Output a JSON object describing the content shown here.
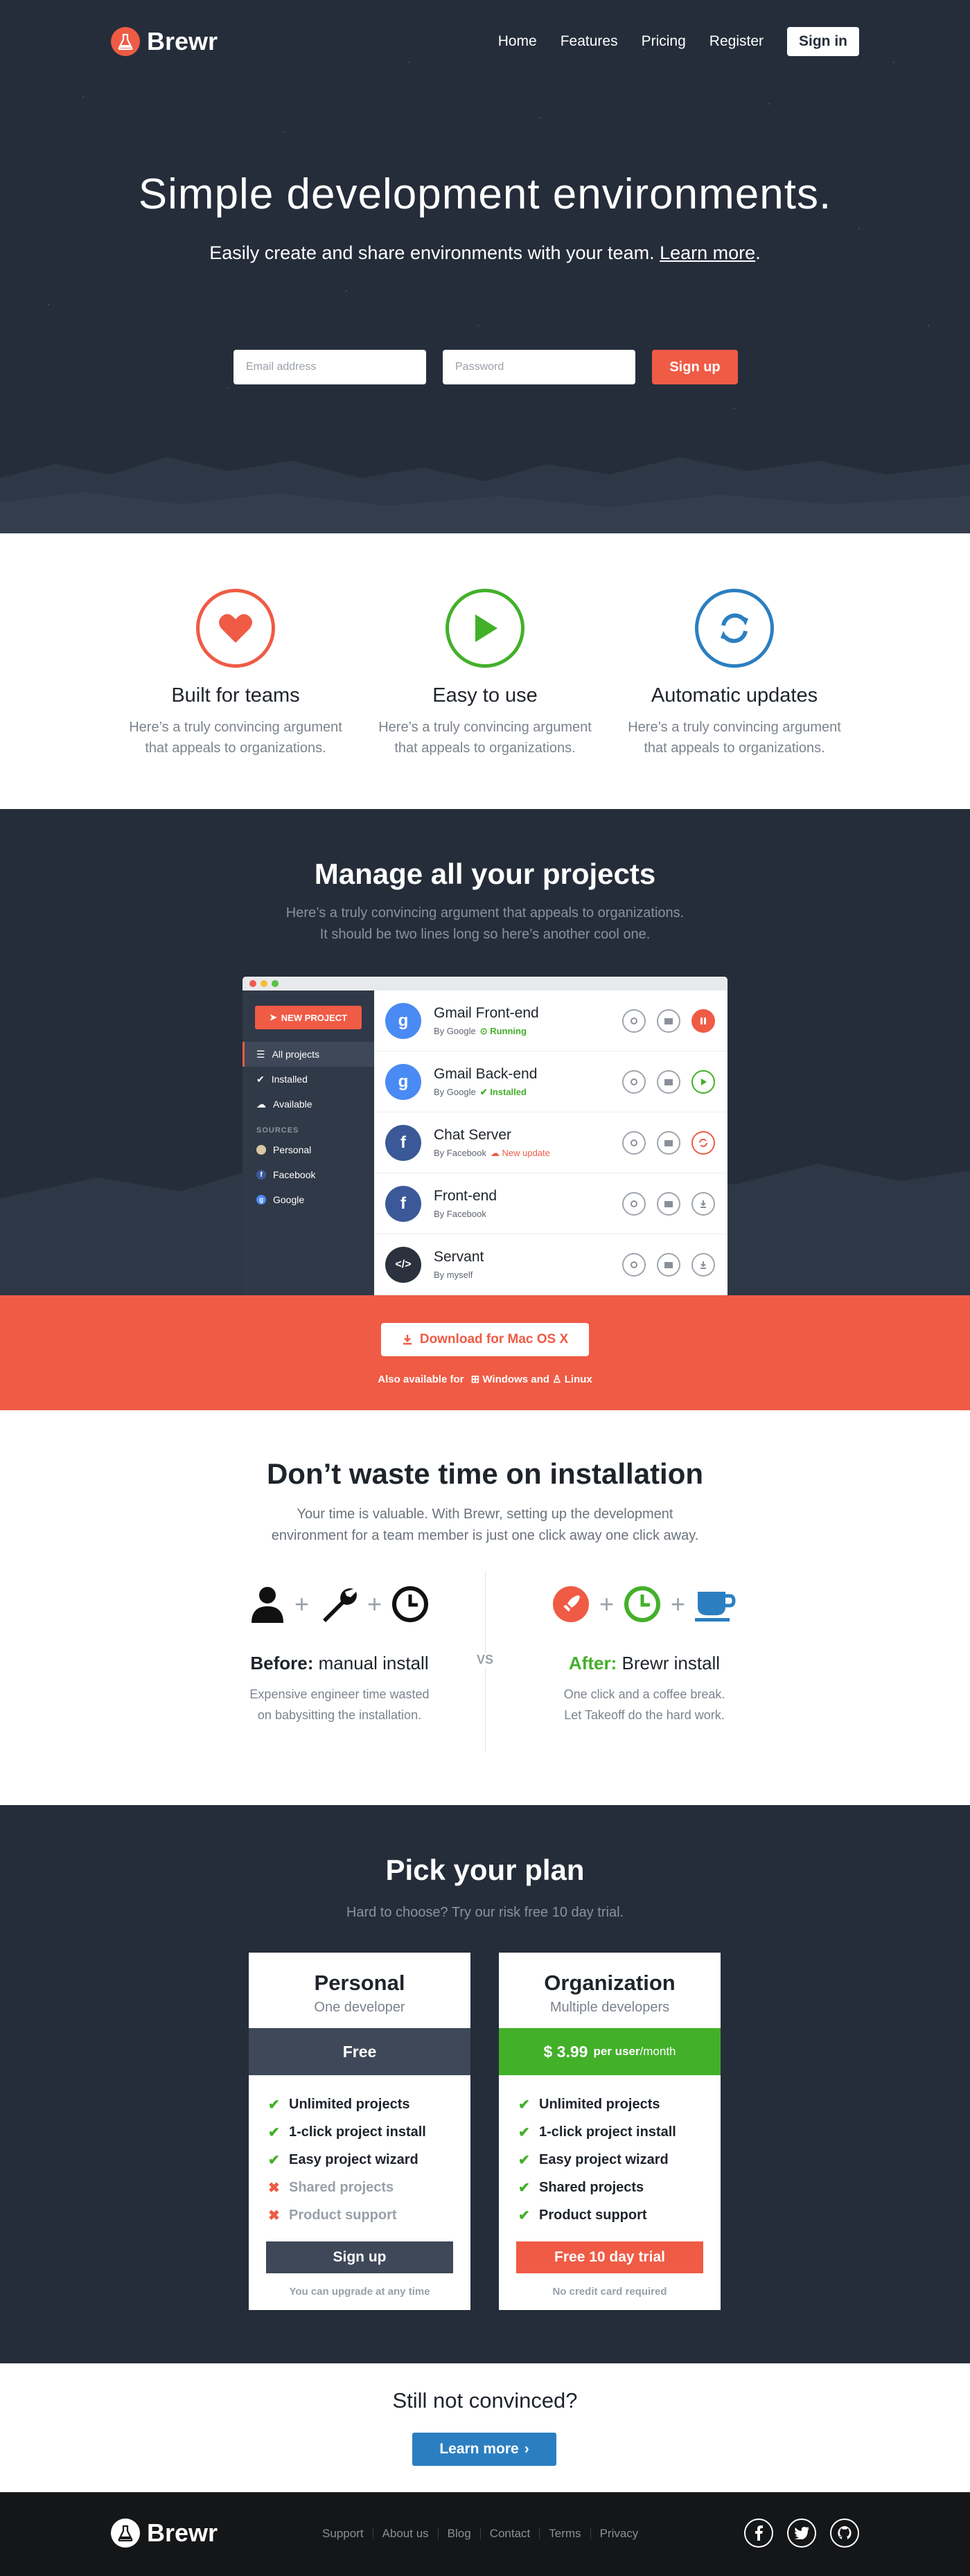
{
  "brand": {
    "name": "Brewr",
    "accent": "#ef5b45",
    "dark": "#252d3a",
    "green": "#43b02a",
    "blue": "#2b7fc1"
  },
  "nav": {
    "links": [
      "Home",
      "Features",
      "Pricing",
      "Register"
    ],
    "signin": "Sign in"
  },
  "hero": {
    "title": "Simple development environments.",
    "subtitle": "Easily create and share environments with your team.",
    "subtitle_link": "Learn more",
    "email_placeholder": "Email address",
    "password_placeholder": "Password",
    "signup": "Sign up"
  },
  "features": [
    {
      "icon": "heart-icon",
      "title": "Built for teams",
      "desc1": "Here’s a truly convincing argument",
      "desc2": "that appeals to organizations."
    },
    {
      "icon": "play-icon",
      "title": "Easy to use",
      "desc1": "Here’s a truly convincing argument",
      "desc2": "that appeals to organizations."
    },
    {
      "icon": "refresh-icon",
      "title": "Automatic updates",
      "desc1": "Here’s a truly convincing argument",
      "desc2": "that appeals to organizations."
    }
  ],
  "manage": {
    "title": "Manage all your projects",
    "desc1": "Here’s a truly convincing argument that appeals to organizations.",
    "desc2": "It should be two lines long so here’s another cool one.",
    "app": {
      "new_project": "NEW PROJECT",
      "nav": [
        "All projects",
        "Installed",
        "Available"
      ],
      "sources_heading": "SOURCES",
      "sources": [
        "Personal",
        "Facebook",
        "Google"
      ],
      "projects": [
        {
          "name": "Gmail Front-end",
          "by": "By Google",
          "status": "Running",
          "avatar": "google-icon"
        },
        {
          "name": "Gmail Back-end",
          "by": "By Google",
          "status": "Installed",
          "avatar": "google-icon"
        },
        {
          "name": "Chat Server",
          "by": "By Facebook",
          "status": "New update",
          "avatar": "facebook-icon"
        },
        {
          "name": "Front-end",
          "by": "By Facebook",
          "status": "",
          "avatar": "facebook-icon"
        },
        {
          "name": "Servant",
          "by": "By myself",
          "status": "",
          "avatar": "code-icon"
        }
      ]
    }
  },
  "download": {
    "button": "Download for Mac OS X",
    "also": "Also available for",
    "windows": "Windows",
    "and": "and",
    "linux": "Linux"
  },
  "install": {
    "title": "Don’t waste time on installation",
    "desc1": "Your time is valuable. With Brewr, setting up the development",
    "desc2": "environment for a team member is just one click away one click away.",
    "before_label": "Before:",
    "before_text": "manual install",
    "before_desc1": "Expensive engineer time wasted",
    "before_desc2": "on babysitting the installation.",
    "vs": "VS",
    "after_label": "After:",
    "after_text": "Brewr install",
    "after_desc1": "One click and a coffee break.",
    "after_desc2": "Let Takeoff do the hard work."
  },
  "pricing": {
    "title": "Pick your plan",
    "desc": "Hard to choose? Try our risk free 10 day trial.",
    "plans": [
      {
        "name": "Personal",
        "sub": "One developer",
        "price": "Free",
        "features": [
          {
            "label": "Unlimited projects",
            "included": true
          },
          {
            "label": "1-click project install",
            "included": true
          },
          {
            "label": "Easy project wizard",
            "included": true
          },
          {
            "label": "Shared projects",
            "included": false
          },
          {
            "label": "Product support",
            "included": false
          }
        ],
        "button": "Sign up",
        "note": "You can upgrade at any time"
      },
      {
        "name": "Organization",
        "sub": "Multiple developers",
        "price": "$ 3.99",
        "price_unit": "per user",
        "price_period": "/month",
        "features": [
          {
            "label": "Unlimited projects",
            "included": true
          },
          {
            "label": "1-click project install",
            "included": true
          },
          {
            "label": "Easy project wizard",
            "included": true
          },
          {
            "label": "Shared projects",
            "included": true
          },
          {
            "label": "Product support",
            "included": true
          }
        ],
        "button": "Free 10 day trial",
        "note": "No credit card required"
      }
    ]
  },
  "convinced": {
    "title": "Still not convinced?",
    "button": "Learn more"
  },
  "footer": {
    "links": [
      "Support",
      "About us",
      "Blog",
      "Contact",
      "Terms",
      "Privacy"
    ],
    "social": [
      "facebook-icon",
      "twitter-icon",
      "github-icon"
    ]
  }
}
